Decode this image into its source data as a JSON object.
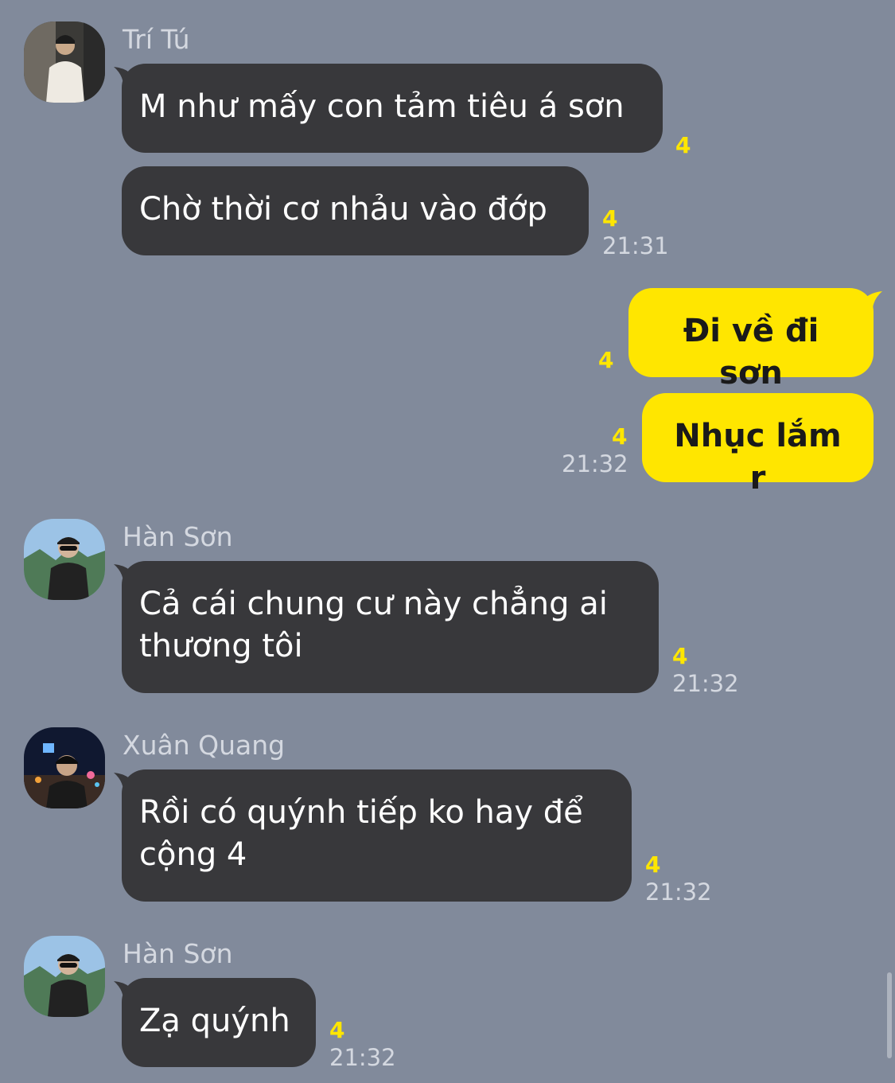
{
  "messages": [
    {
      "sender": "Trí Tú",
      "text": "M như mấy con tảm tiêu á sơn",
      "unread": "4"
    },
    {
      "text": "Chờ thời cơ nhảu vào đớp",
      "unread": "4",
      "time": "21:31"
    },
    {
      "text": "Đi về đi sơn",
      "unread": "4"
    },
    {
      "text": "Nhục lắm r",
      "unread": "4",
      "time": "21:32"
    },
    {
      "sender": "Hàn Sơn",
      "text": "Cả cái chung cư này chẳng ai thương tôi",
      "unread": "4",
      "time": "21:32"
    },
    {
      "sender": "Xuân Quang",
      "text": "Rồi có quýnh tiếp ko hay để cộng 4",
      "unread": "4",
      "time": "21:32"
    },
    {
      "sender": "Hàn Sơn",
      "text": "Zạ quýnh",
      "unread": "4",
      "time": "21:32"
    }
  ],
  "colors": {
    "background": "#818a9b",
    "incoming_bubble": "#38383b",
    "outgoing_bubble": "#ffe600",
    "unread_count": "#ffe600"
  }
}
